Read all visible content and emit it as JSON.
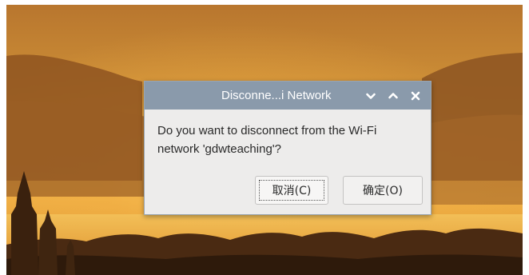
{
  "dialog": {
    "title": "Disconne...i Network",
    "message": "Do you want to disconnect from the Wi-Fi network 'gdwteaching'?",
    "buttons": {
      "cancel_label": "取消(C)",
      "ok_label": "确定(O)"
    },
    "titlebar_icons": [
      "chevron-down-icon",
      "chevron-up-icon",
      "close-icon"
    ]
  },
  "colors": {
    "titlebar": "#8a9aab",
    "dialog_bg": "#edeceb",
    "sky_top": "#c07a2c",
    "sky_glow": "#f2b042"
  }
}
